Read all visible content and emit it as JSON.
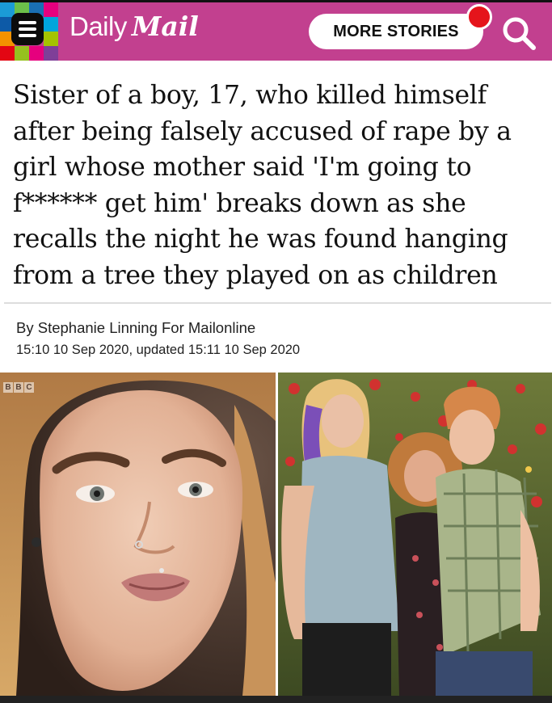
{
  "header": {
    "logo_daily": "Daily",
    "logo_mail": "Mail",
    "more_stories_label": "MORE STORIES",
    "brand_color": "#c2408f",
    "notification_color": "#e5141b"
  },
  "article": {
    "headline": "Sister of a boy, 17, who killed himself after being falsely accused of rape by a girl whose mother said 'I'm going to f****** get him' breaks down as she recalls the night he was found hanging from a tree they played on as children",
    "byline": "By Stephanie Linning For Mailonline",
    "dateline": "15:10 10 Sep 2020, updated 15:11 10 Sep 2020"
  },
  "photos": {
    "left_watermark": [
      "B",
      "B",
      "C"
    ]
  },
  "icons": [
    "menu-icon",
    "search-icon"
  ]
}
